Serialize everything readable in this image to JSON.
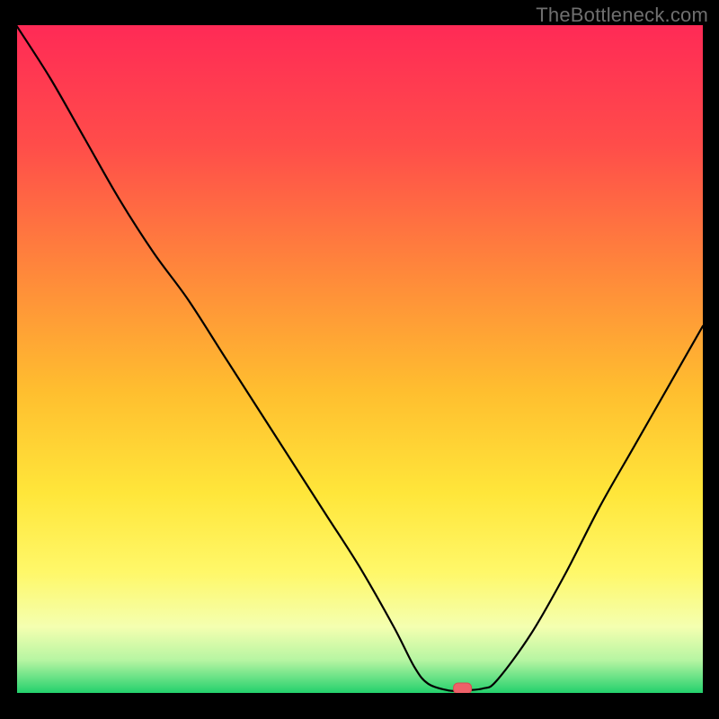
{
  "watermark": "TheBottleneck.com",
  "chart_data": {
    "type": "line",
    "title": "",
    "xlabel": "",
    "ylabel": "",
    "xlim": [
      0,
      100
    ],
    "ylim": [
      0,
      100
    ],
    "grid": false,
    "legend": false,
    "background_gradient_top": "#ff2a56",
    "background_gradient_bottom": "#1fd06b",
    "x": [
      0,
      5,
      10,
      15,
      20,
      25,
      30,
      35,
      40,
      45,
      50,
      55,
      58,
      60,
      63,
      65,
      68,
      70,
      75,
      80,
      85,
      90,
      95,
      100
    ],
    "y": [
      100,
      92,
      83,
      74,
      66,
      59,
      51,
      43,
      35,
      27,
      19,
      10,
      4,
      1.5,
      0.5,
      0.5,
      0.8,
      2,
      9,
      18,
      28,
      37,
      46,
      55
    ],
    "marker": {
      "x": 65,
      "y": 0.8,
      "color": "#ef6068"
    },
    "note": "V-shaped bottleneck curve; minimum (green zone) around x≈63–67."
  }
}
